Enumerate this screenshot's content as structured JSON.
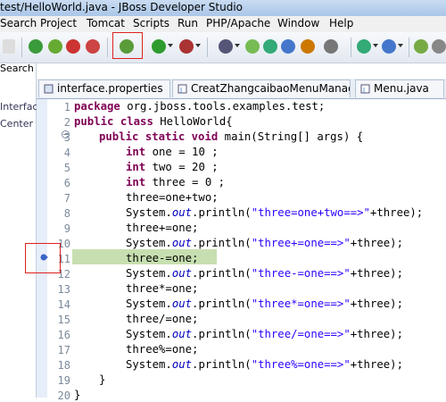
{
  "window": {
    "title": "test/HelloWorld.java - JBoss Developer Studio"
  },
  "menu": [
    "Search",
    "Project",
    "Tomcat",
    "Scripts",
    "Run",
    "PHP/Apache",
    "Window",
    "Help"
  ],
  "left_panel": {
    "label_a": "Search",
    "label_b": "Interfac",
    "label_c": "Center"
  },
  "tabs": [
    {
      "label": "interface.properties"
    },
    {
      "label": "CreatZhangcaibaoMenuManag"
    },
    {
      "label": "Menu.java"
    }
  ],
  "editor": {
    "line_numbers": [
      "1",
      "2",
      "3",
      "4",
      "5",
      "6",
      "7",
      "8",
      "9",
      "10",
      "11",
      "12",
      "13",
      "14",
      "15",
      "16",
      "17",
      "18",
      "19",
      "20"
    ],
    "highlighted_line": "11",
    "breakpoint_icon": "breakpoint-arrow-icon"
  },
  "code": {
    "l1a": "package",
    "l1b": " org.jboss.tools.examples.test;",
    "l2a": "public",
    "l2b": " ",
    "l2c": "class",
    "l2d": " HelloWorld{",
    "l3a": "public",
    "l3b": " ",
    "l3c": "static",
    "l3d": " ",
    "l3e": "void",
    "l3f": " main(String[] args) {",
    "l4a": "int",
    "l4b": " one = 10 ;",
    "l5a": "int",
    "l5b": " two = 20 ;",
    "l6a": "int",
    "l6b": " three = 0 ;",
    "l7": "three=one+two;",
    "l8a": "System.",
    "l8b": "out",
    "l8c": ".println(",
    "l8d": "\"three=one+two==>\"",
    "l8e": "+three);",
    "l9": "three+=one;",
    "l10a": "System.",
    "l10b": "out",
    "l10c": ".println(",
    "l10d": "\"three+=one==>\"",
    "l10e": "+three);",
    "l11": "three-=one;",
    "l12a": "System.",
    "l12b": "out",
    "l12c": ".println(",
    "l12d": "\"three-=one==>\"",
    "l12e": "+three);",
    "l13": "three*=one;",
    "l14a": "System.",
    "l14b": "out",
    "l14c": ".println(",
    "l14d": "\"three*=one==>\"",
    "l14e": "+three);",
    "l15": "three/=one;",
    "l16a": "System.",
    "l16b": "out",
    "l16c": ".println(",
    "l16d": "\"three/=one==>\"",
    "l16e": "+three);",
    "l17": "three%=one;",
    "l18a": "System.",
    "l18b": "out",
    "l18c": ".println(",
    "l18d": "\"three%=one==>\"",
    "l18e": "+three);",
    "l19": "}",
    "l20": "}"
  },
  "colors": {
    "keyword": "#7f0055",
    "string": "#2a00ff",
    "field": "#0000c0",
    "highlight": "#c7dfb0",
    "annotation_box": "#e02020"
  }
}
